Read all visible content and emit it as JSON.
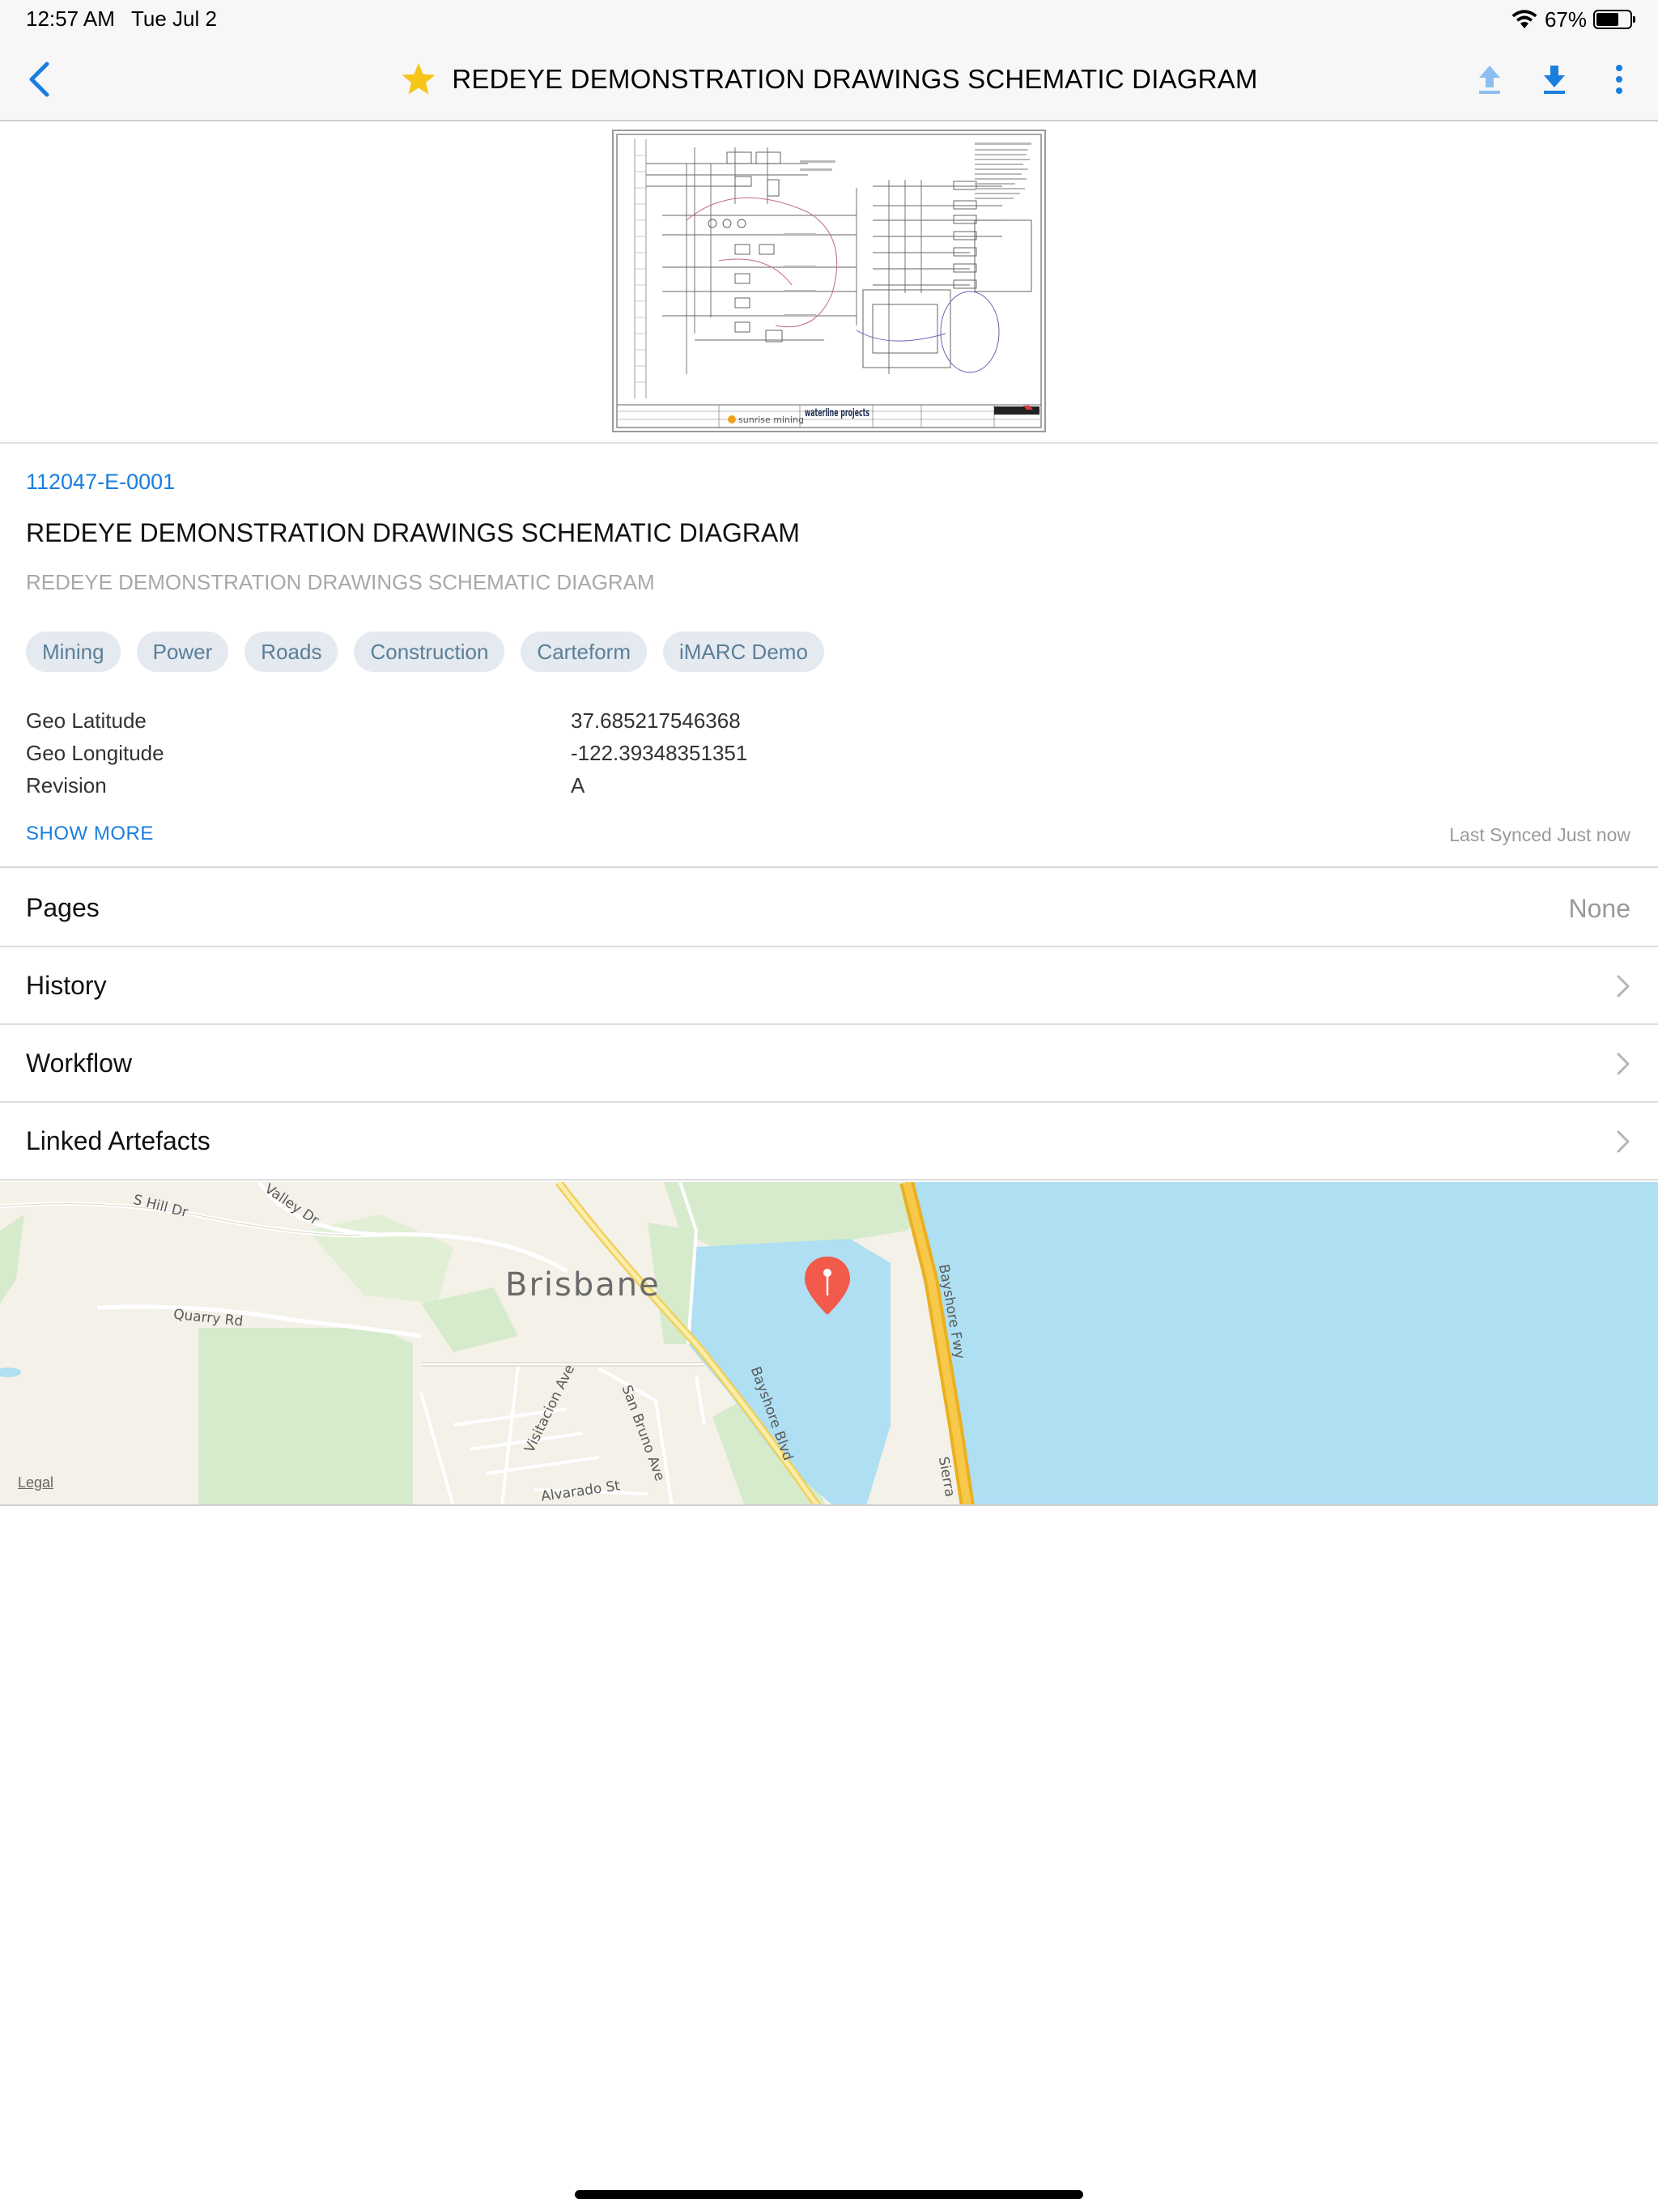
{
  "status": {
    "time": "12:57 AM",
    "date": "Tue Jul 2",
    "battery": "67%",
    "battery_level": 0.67
  },
  "nav": {
    "title": "REDEYE DEMONSTRATION DRAWINGS SCHEMATIC DIAGRAM",
    "favorite_color": "#f5c518",
    "accent_color": "#1a7ee0"
  },
  "drawing": {
    "company_label": "sunrise mining",
    "logo_label": "waterline projects"
  },
  "document": {
    "number": "112047-E-0001",
    "title": "REDEYE DEMONSTRATION DRAWINGS SCHEMATIC DIAGRAM",
    "subtitle": "REDEYE DEMONSTRATION DRAWINGS SCHEMATIC DIAGRAM",
    "tags": [
      "Mining",
      "Power",
      "Roads",
      "Construction",
      "Carteform",
      "iMARC Demo"
    ],
    "metadata": [
      {
        "key": "Geo Latitude",
        "value": "37.685217546368"
      },
      {
        "key": "Geo Longitude",
        "value": "-122.39348351351"
      },
      {
        "key": "Revision",
        "value": "A"
      }
    ],
    "show_more": "SHOW MORE",
    "last_synced": "Last Synced Just now"
  },
  "list": {
    "pages_label": "Pages",
    "pages_value": "None",
    "history_label": "History",
    "workflow_label": "Workflow",
    "linked_label": "Linked Artefacts"
  },
  "map": {
    "city": "Brisbane",
    "streets": {
      "s_hill": "S Hill Dr",
      "valley": "Valley Dr",
      "quarry": "Quarry Rd",
      "visitacion": "Visitacion Ave",
      "san_bruno": "San Bruno Ave",
      "alvarado": "Alvarado St",
      "bayshore_blvd": "Bayshore Blvd",
      "bayshore_fwy": "Bayshore Fwy",
      "sierra": "Sierra"
    },
    "legal": "Legal",
    "water_color": "#aedff2",
    "land_color": "#f4f1e8",
    "park_color": "#d6ebcb",
    "pin_color": "#f25a4b"
  }
}
